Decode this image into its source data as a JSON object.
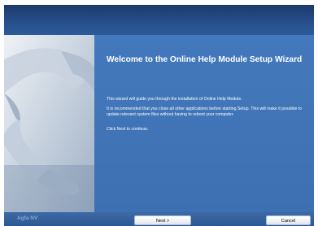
{
  "wizard": {
    "title": "Welcome to the Online Help Module Setup Wizard",
    "paragraphs": [
      "This wizard will guide you through the installation of Online Help Module.",
      "It is recommended that you close all other applications before starting Setup. This will make it possible to update relevant system files without having to reboot your computer.",
      "Click Next to continue."
    ]
  },
  "footer": {
    "brand": "Agfa NV",
    "next_label": "Next >",
    "cancel_label": "Cancel"
  },
  "colors": {
    "titlebar": "#28508d",
    "panel": "#3d70b3",
    "brand_text": "#8aa6cc"
  },
  "icons": {
    "side_image": "hand-frame-image"
  }
}
